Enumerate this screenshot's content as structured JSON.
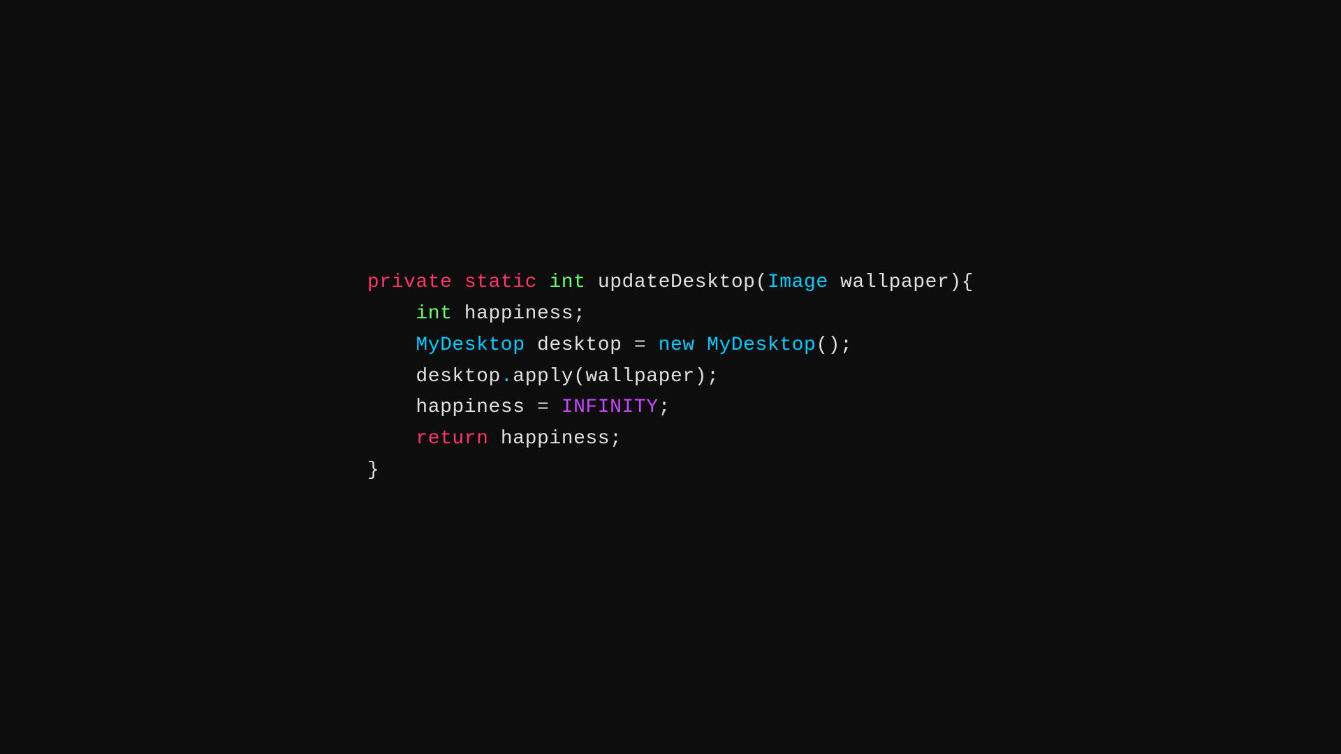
{
  "code": {
    "lines": [
      {
        "id": "line1",
        "parts": [
          {
            "text": "private",
            "class": "keyword-private"
          },
          {
            "text": " ",
            "class": "plain"
          },
          {
            "text": "static",
            "class": "keyword-static"
          },
          {
            "text": " ",
            "class": "plain"
          },
          {
            "text": "int",
            "class": "keyword-int"
          },
          {
            "text": " updateDesktop(",
            "class": "plain"
          },
          {
            "text": "Image",
            "class": "type-image"
          },
          {
            "text": " wallpaper){",
            "class": "plain"
          }
        ]
      },
      {
        "id": "line2",
        "parts": [
          {
            "text": "    ",
            "class": "plain"
          },
          {
            "text": "int",
            "class": "keyword-int"
          },
          {
            "text": " happiness;",
            "class": "plain"
          }
        ]
      },
      {
        "id": "line3",
        "parts": [
          {
            "text": "    ",
            "class": "plain"
          },
          {
            "text": "MyDesktop",
            "class": "type-mydesktop"
          },
          {
            "text": " desktop = ",
            "class": "plain"
          },
          {
            "text": "new",
            "class": "keyword-new"
          },
          {
            "text": " ",
            "class": "plain"
          },
          {
            "text": "MyDesktop",
            "class": "type-mydesktop"
          },
          {
            "text": "();",
            "class": "plain"
          }
        ]
      },
      {
        "id": "line4",
        "parts": [
          {
            "text": "    desktop",
            "class": "plain"
          },
          {
            "text": ".",
            "class": "dot"
          },
          {
            "text": "apply(wallpaper);",
            "class": "plain"
          }
        ]
      },
      {
        "id": "line5",
        "parts": [
          {
            "text": "    happiness = ",
            "class": "plain"
          },
          {
            "text": "INFINITY",
            "class": "constant"
          },
          {
            "text": ";",
            "class": "plain"
          }
        ]
      },
      {
        "id": "line6",
        "parts": [
          {
            "text": "    ",
            "class": "plain"
          },
          {
            "text": "return",
            "class": "keyword-return"
          },
          {
            "text": " happiness;",
            "class": "plain"
          }
        ]
      },
      {
        "id": "line7",
        "parts": [
          {
            "text": "}",
            "class": "plain"
          }
        ]
      }
    ]
  }
}
